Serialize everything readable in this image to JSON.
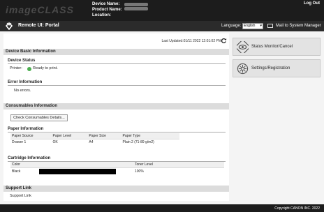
{
  "header": {
    "brand": "imageCLASS",
    "device_name_label": "Device Name:",
    "product_name_label": "Product Name:",
    "location_label": "Location:",
    "logout": "Log Out"
  },
  "titlebar": {
    "title": "Remote UI: Portal",
    "language_label": "Language:",
    "language_value": "English",
    "mail_link": "Mail to System Manager"
  },
  "main": {
    "last_updated": "Last Updated:01/11 2022 12:01:02 PM",
    "device_basic": {
      "heading": "Device Basic Information",
      "status_heading": "Device Status",
      "printer_label": "Printer:",
      "printer_status": "Ready to print.",
      "error_heading": "Error Information",
      "error_text": "No errors."
    },
    "consumables": {
      "heading": "Consumables Information",
      "check_button": "Check Consumables Details...",
      "paper_heading": "Paper Information",
      "paper_columns": [
        "Paper Source",
        "Paper Level",
        "Paper Size",
        "Paper Type"
      ],
      "paper_rows": [
        [
          "Drawer 1",
          "OK",
          "A4",
          "Plain 2 (71-89 g/m2)"
        ]
      ],
      "cartridge_heading": "Cartridge Information",
      "cartridge_columns": [
        "Color",
        "Toner Level"
      ],
      "cartridge_rows": [
        {
          "color": "Black",
          "level": "100%"
        }
      ]
    },
    "support": {
      "heading": "Support Link",
      "link": "Support Link"
    }
  },
  "sidebar": {
    "status_monitor": "Status Monitor/Cancel",
    "settings": "Settings/Registration"
  },
  "footer": {
    "copyright": "Copyright CANON INC. 2022"
  },
  "colors": {
    "status_ready": "#4caf50",
    "header_bg": "#1c1c1c"
  }
}
